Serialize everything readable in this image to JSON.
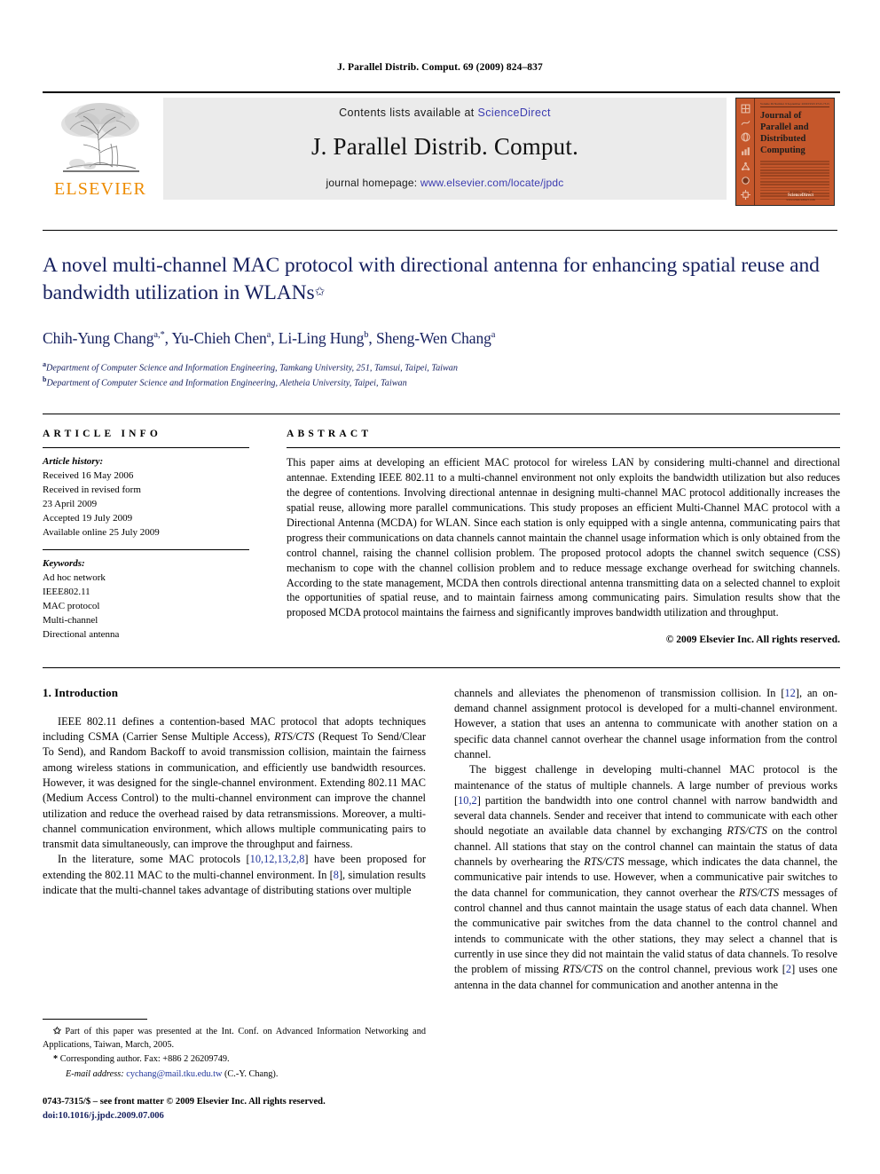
{
  "running_head": "J. Parallel Distrib. Comput. 69 (2009) 824–837",
  "masthead": {
    "publisher_name": "ELSEVIER",
    "contents_prefix": "Contents lists available at ",
    "contents_link": "ScienceDirect",
    "journal_title": "J. Parallel Distrib. Comput.",
    "homepage_prefix": "journal homepage: ",
    "homepage_url": "www.elsevier.com/locate/jpdc",
    "cover": {
      "title_line_1": "Journal of",
      "title_line_2": "Parallel and",
      "title_line_3": "Distributed",
      "title_line_4": "Computing",
      "rule_left": "Volume 69",
      "rule_mid": "Number 9",
      "rule_mid2": "September 2009",
      "rule_right": "ISSN 0743-7315",
      "badge": "ScienceDirect",
      "badge_sub": "www.sciencedirect.com",
      "available_label": "Available online at"
    }
  },
  "article": {
    "title": "A novel multi-channel MAC protocol with directional antenna for enhancing spatial reuse and bandwidth utilization in WLANs",
    "title_marker": "✩",
    "authors": [
      {
        "name": "Chih-Yung Chang",
        "sup": "a,*"
      },
      {
        "name": "Yu-Chieh Chen",
        "sup": "a"
      },
      {
        "name": "Li-Ling Hung",
        "sup": "b"
      },
      {
        "name": "Sheng-Wen Chang",
        "sup": "a"
      }
    ],
    "affiliations": [
      {
        "mark": "a",
        "text": "Department of Computer Science and Information Engineering, Tamkang University, 251, Tamsui, Taipei, Taiwan"
      },
      {
        "mark": "b",
        "text": "Department of Computer Science and Information Engineering, Aletheia University, Taipei, Taiwan"
      }
    ]
  },
  "info": {
    "heading": "ARTICLE INFO",
    "history_label": "Article history:",
    "history": [
      "Received 16 May 2006",
      "Received in revised form",
      "23 April 2009",
      "Accepted 19 July 2009",
      "Available online 25 July 2009"
    ],
    "keywords_label": "Keywords:",
    "keywords": [
      "Ad hoc network",
      "IEEE802.11",
      "MAC protocol",
      "Multi-channel",
      "Directional antenna"
    ]
  },
  "abstract": {
    "heading": "ABSTRACT",
    "text": "This paper aims at developing an efficient MAC protocol for wireless LAN by considering multi-channel and directional antennae. Extending IEEE 802.11 to a multi-channel environment not only exploits the bandwidth utilization but also reduces the degree of contentions. Involving directional antennae in designing multi-channel MAC protocol additionally increases the spatial reuse, allowing more parallel communications. This study proposes an efficient Multi-Channel MAC protocol with a Directional Antenna (MCDA) for WLAN. Since each station is only equipped with a single antenna, communicating pairs that progress their communications on data channels cannot maintain the channel usage information which is only obtained from the control channel, raising the channel collision problem. The proposed protocol adopts the channel switch sequence (CSS) mechanism to cope with the channel collision problem and to reduce message exchange overhead for switching channels. According to the state management, MCDA then controls directional antenna transmitting data on a selected channel to exploit the opportunities of spatial reuse, and to maintain fairness among communicating pairs. Simulation results show that the proposed MCDA protocol maintains the fairness and significantly improves bandwidth utilization and throughput.",
    "copyright": "© 2009 Elsevier Inc. All rights reserved."
  },
  "body": {
    "section_heading": "1. Introduction",
    "left_paragraphs": [
      "IEEE 802.11 defines a contention-based MAC protocol that adopts techniques including CSMA (Carrier Sense Multiple Access), RTS/CTS (Request To Send/Clear To Send), and Random Backoff to avoid transmission collision, maintain the fairness among wireless stations in communication, and efficiently use bandwidth resources. However, it was designed for the single-channel environment. Extending 802.11 MAC (Medium Access Control) to the multi-channel environment can improve the channel utilization and reduce the overhead raised by data retransmissions. Moreover, a multi-channel communication environment, which allows multiple communicating pairs to transmit data simultaneously, can improve the throughput and fairness.",
      "In the literature, some MAC protocols [10,12,13,2,8] have been proposed for extending the 802.11 MAC to the multi-channel environment. In [8], simulation results indicate that the multi-channel takes advantage of distributing stations over multiple"
    ],
    "right_paragraphs": [
      "channels and alleviates the phenomenon of transmission collision. In [12], an on-demand channel assignment protocol is developed for a multi-channel environment. However, a station that uses an antenna to communicate with another station on a specific data channel cannot overhear the channel usage information from the control channel.",
      "The biggest challenge in developing multi-channel MAC protocol is the maintenance of the status of multiple channels. A large number of previous works [10,2] partition the bandwidth into one control channel with narrow bandwidth and several data channels. Sender and receiver that intend to communicate with each other should negotiate an available data channel by exchanging RTS/CTS on the control channel. All stations that stay on the control channel can maintain the status of data channels by overhearing the RTS/CTS message, which indicates the data channel, the communicative pair intends to use. However, when a communicative pair switches to the data channel for communication, they cannot overhear the RTS/CTS messages of control channel and thus cannot maintain the usage status of each data channel. When the communicative pair switches from the data channel to the control channel and intends to communicate with the other stations, they may select a channel that is currently in use since they did not maintain the valid status of data channels. To resolve the problem of missing RTS/CTS on the control channel, previous work [2] uses one antenna in the data channel for communication and another antenna in the"
    ]
  },
  "footnotes": {
    "star_mark": "✩",
    "star_text": "Part of this paper was presented at the Int. Conf. on Advanced Information Networking and Applications, Taiwan, March, 2005.",
    "corresponding_mark": "*",
    "corresponding_text": "Corresponding author. Fax: +886 2 26209749.",
    "email_label": "E-mail address:",
    "email": "cychang@mail.tku.edu.tw",
    "email_attrib": "(C.-Y. Chang).",
    "issn_line": "0743-7315/$ – see front matter © 2009 Elsevier Inc. All rights reserved.",
    "doi_line": "doi:10.1016/j.jpdc.2009.07.006"
  }
}
